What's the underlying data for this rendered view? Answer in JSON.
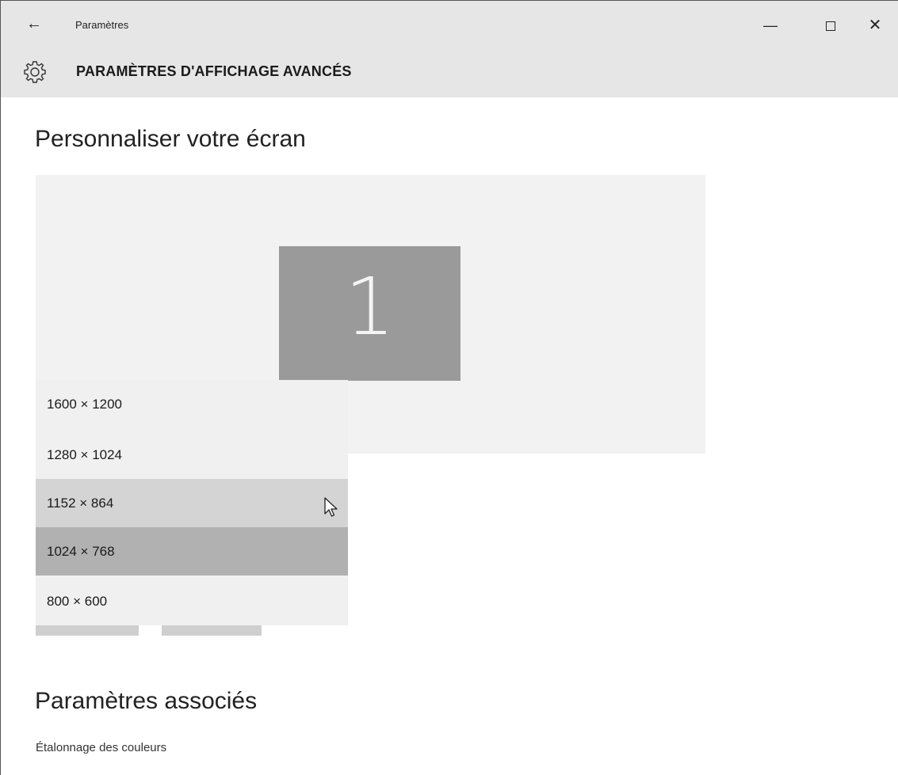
{
  "titlebar": {
    "back_icon": "arrow-left-icon",
    "title": "Paramètres",
    "minimize_glyph": "—",
    "close_glyph": "✕"
  },
  "header": {
    "icon": "gear-icon",
    "title": "PARAMÈTRES D'AFFICHAGE AVANCÉS"
  },
  "main": {
    "section1_title": "Personnaliser votre écran",
    "monitor_number": "1",
    "resolution_options": [
      {
        "label": "1600 × 1200"
      },
      {
        "label": "1280 × 1024"
      },
      {
        "label": "1152 × 864",
        "state": "hover"
      },
      {
        "label": "1024 × 768",
        "state": "selected"
      },
      {
        "label": "800 × 600"
      }
    ],
    "section2_title": "Paramètres associés",
    "link_label": "Étalonnage des couleurs"
  },
  "colors": {
    "titlebar_bg": "#e6e6e6",
    "monitor_bg": "#9a9a9a",
    "display_area_bg": "#f2f2f2",
    "dropdown_bg": "#f0f0f0",
    "hover_bg": "#d4d4d4",
    "selected_bg": "#b1b1b1"
  }
}
